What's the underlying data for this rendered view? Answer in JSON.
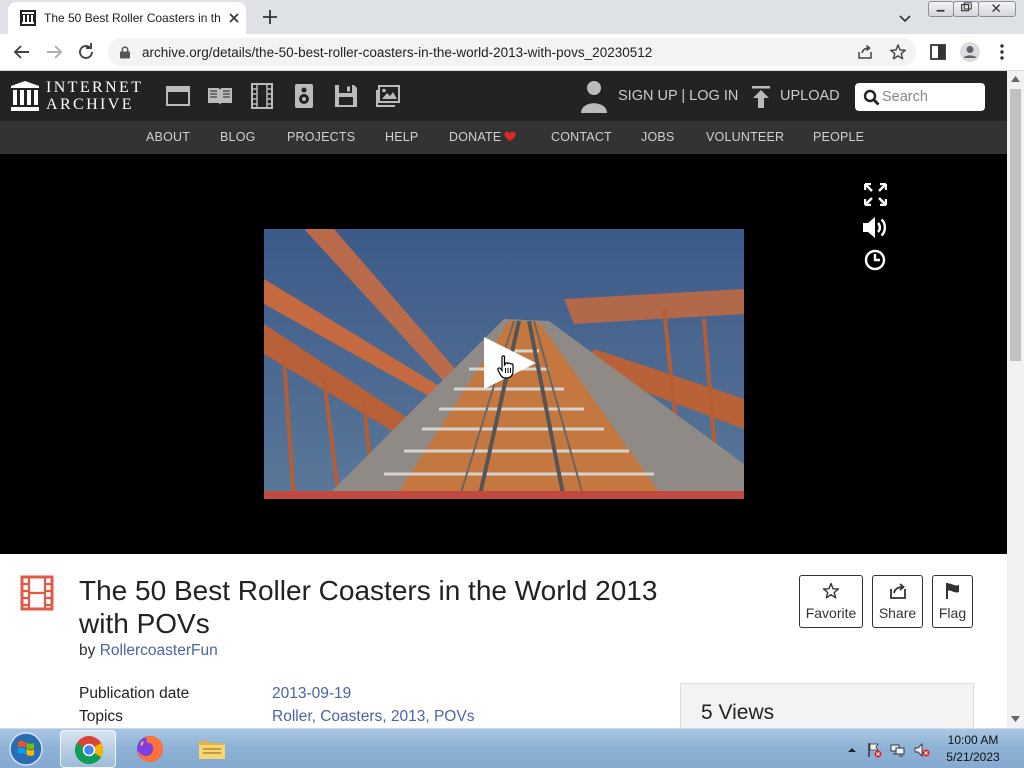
{
  "browser": {
    "tab_title": "The 50 Best Roller Coasters in the World 2013 with POVs",
    "url": "archive.org/details/the-50-best-roller-coasters-in-the-world-2013-with-povs_20230512"
  },
  "ia_header": {
    "logo_line1": "INTERNET",
    "logo_line2": "ARCHIVE",
    "signin": "SIGN UP | LOG IN",
    "upload": "UPLOAD",
    "search_placeholder": "Search"
  },
  "nav": {
    "items": [
      "ABOUT",
      "BLOG",
      "PROJECTS",
      "HELP",
      "DONATE",
      "CONTACT",
      "JOBS",
      "VOLUNTEER",
      "PEOPLE"
    ]
  },
  "item": {
    "title": "The 50 Best Roller Coasters in the World 2013 with POVs",
    "by_prefix": "by",
    "creator": "RollercoasterFun",
    "actions": {
      "favorite": "Favorite",
      "share": "Share",
      "flag": "Flag"
    },
    "metadata": [
      {
        "key": "Publication date",
        "value": "2013-09-19"
      },
      {
        "key": "Topics",
        "value": "Roller, Coasters, 2013, POVs"
      }
    ],
    "views": "5 Views"
  },
  "taskbar": {
    "time": "10:00 AM",
    "date": "5/21/2023"
  },
  "colors": {
    "ia_header": "#232323",
    "ia_nav": "#333333",
    "link": "#4b64a5",
    "donate_heart": "#e02626",
    "film_icon": "#e05a47"
  }
}
